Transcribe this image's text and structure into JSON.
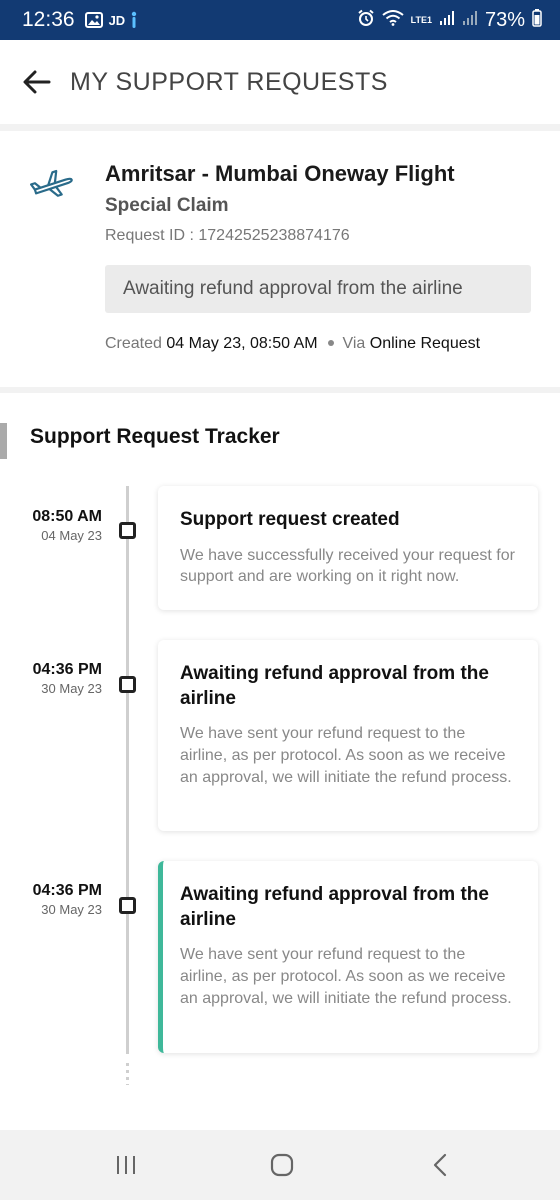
{
  "status_bar": {
    "time": "12:36",
    "carrier_badge": "JD",
    "battery_percent": "73%",
    "network_label": "LTE1"
  },
  "header": {
    "title": "MY SUPPORT REQUESTS"
  },
  "request": {
    "trip_title": "Amritsar - Mumbai Oneway Flight",
    "claim_type": "Special Claim",
    "request_id": "Request ID : 17242525238874176",
    "status": "Awaiting refund approval from the airline",
    "created_label": "Created",
    "created_value": "04 May 23, 08:50 AM",
    "via_label": "Via",
    "via_value": "Online Request"
  },
  "tracker": {
    "title": "Support Request Tracker",
    "events": [
      {
        "time": "08:50 AM",
        "date": "04 May 23",
        "title": "Support request created",
        "description": "We have successfully received your request for support and are working on it right now."
      },
      {
        "time": "04:36 PM",
        "date": "30 May 23",
        "title": "Awaiting refund approval from the airline",
        "description": "We have sent your refund request to the airline, as per protocol. As soon as we receive an approval, we will initiate the refund process."
      },
      {
        "time": "04:36 PM",
        "date": "30 May 23",
        "title": "Awaiting refund approval from the airline",
        "description": "We have sent your refund request to the airline, as per protocol. As soon as we receive an approval, we will initiate the refund process."
      }
    ]
  },
  "colors": {
    "status_bar_bg": "#123a73",
    "active_accent": "#3fb89a",
    "plane_icon": "#2a6b8a"
  }
}
